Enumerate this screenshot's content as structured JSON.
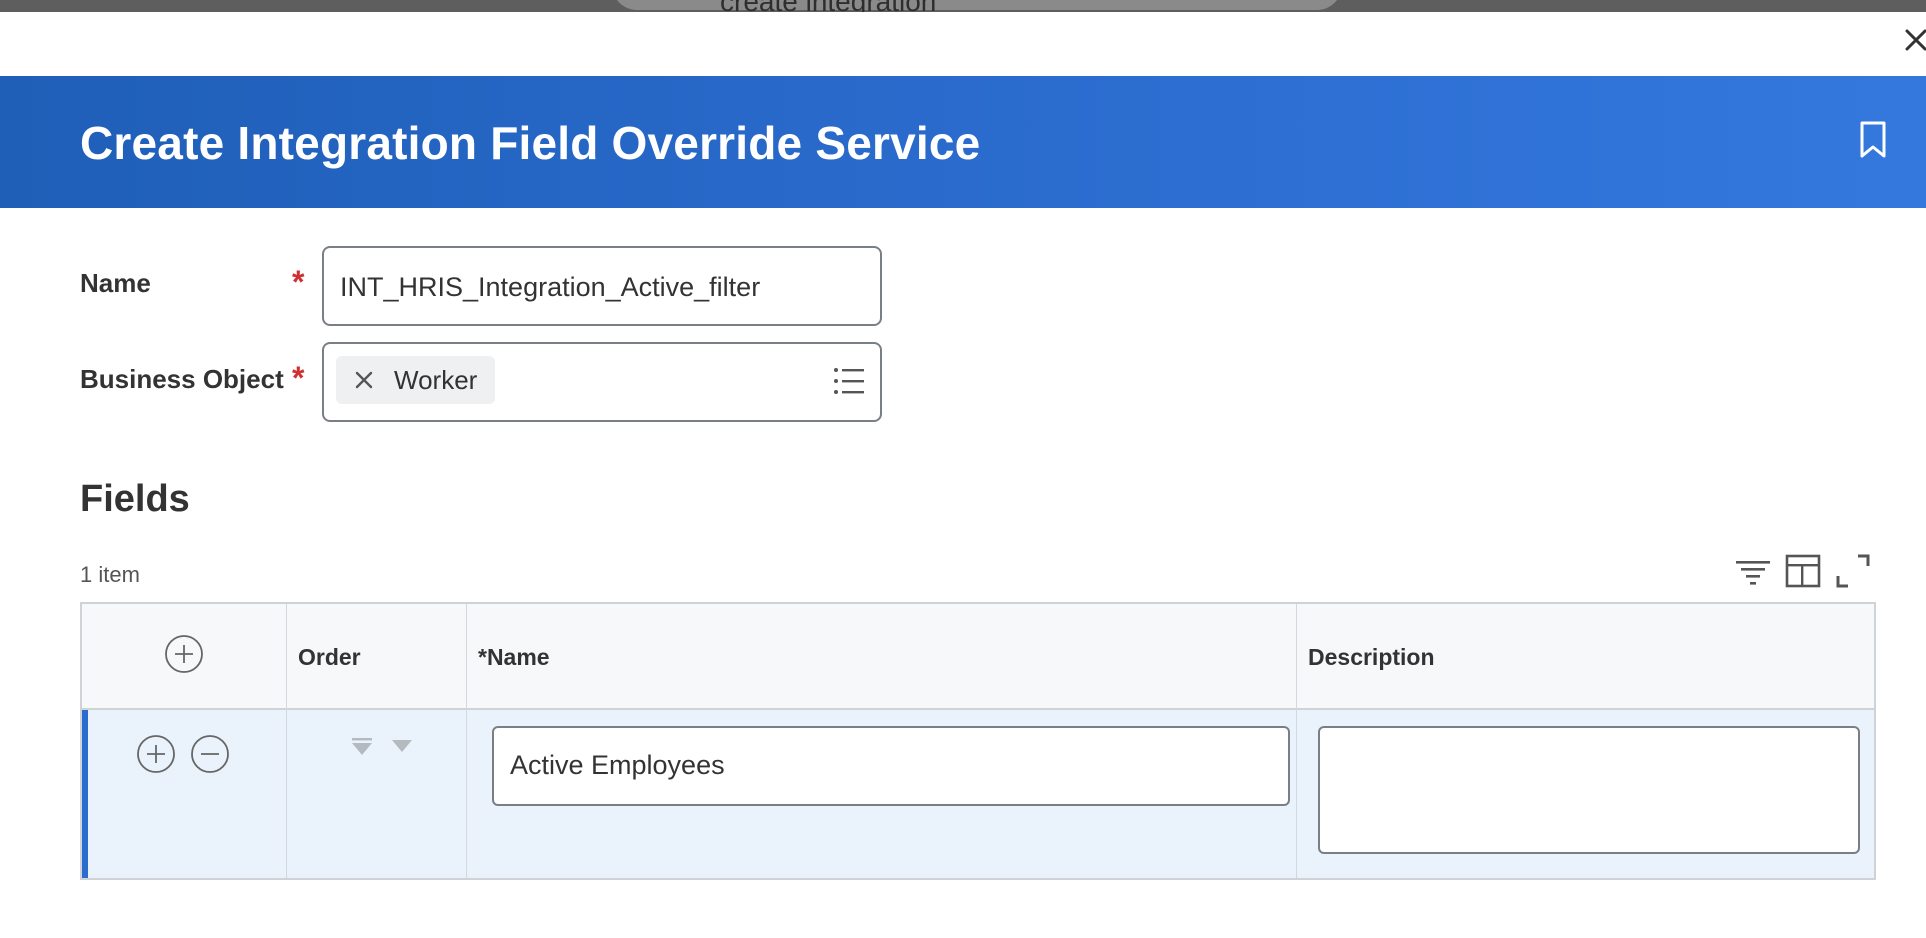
{
  "background": {
    "search_text": "create integration"
  },
  "dialog": {
    "title": "Create Integration Field Override Service",
    "close_icon": "close-icon",
    "bookmark_icon": "bookmark-icon"
  },
  "form": {
    "name": {
      "label": "Name",
      "required_mark": "*",
      "value": "INT_HRIS_Integration_Active_filter"
    },
    "business_object": {
      "label": "Business Object",
      "required_mark": "*",
      "selected": "Worker",
      "remove_icon": "x-icon",
      "prompt_icon": "list-icon"
    }
  },
  "fields_section": {
    "title": "Fields",
    "item_count": "1 item",
    "toolbar_icons": [
      "filter-icon",
      "columns-icon",
      "fullscreen-icon"
    ],
    "columns": [
      "Order",
      "*Name",
      "Description"
    ],
    "rows": [
      {
        "name": "Active Employees",
        "description": ""
      }
    ]
  },
  "colors": {
    "header_start": "#1f5fb8",
    "header_end": "#3478de",
    "required": "#d0302f",
    "row_highlight": "#eaf3fb",
    "row_accent": "#2b6ccf"
  }
}
